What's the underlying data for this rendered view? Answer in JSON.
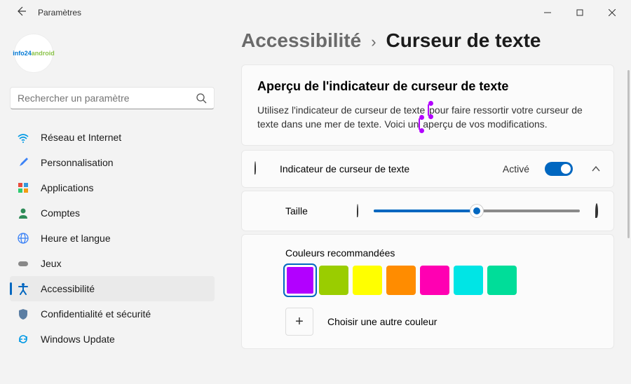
{
  "window": {
    "title": "Paramètres"
  },
  "avatar": {
    "brand_a": "info24",
    "brand_b": "android"
  },
  "search": {
    "placeholder": "Rechercher un paramètre"
  },
  "nav": {
    "items": [
      {
        "icon": "wifi",
        "label": "Réseau et Internet",
        "color": "#0099e5"
      },
      {
        "icon": "brush",
        "label": "Personnalisation",
        "color": "#3b82f6"
      },
      {
        "icon": "apps",
        "label": "Applications",
        "color": "#5b5b5b"
      },
      {
        "icon": "person",
        "label": "Comptes",
        "color": "#2e8b57"
      },
      {
        "icon": "globe",
        "label": "Heure et langue",
        "color": "#3b82f6"
      },
      {
        "icon": "gamepad",
        "label": "Jeux",
        "color": "#888"
      },
      {
        "icon": "accessibility",
        "label": "Accessibilité",
        "color": "#0067c0",
        "selected": true
      },
      {
        "icon": "shield",
        "label": "Confidentialité et sécurité",
        "color": "#5b7ea3"
      },
      {
        "icon": "sync",
        "label": "Windows Update",
        "color": "#0099e5"
      }
    ]
  },
  "breadcrumb": {
    "parent": "Accessibilité",
    "sep": "›",
    "current": "Curseur de texte"
  },
  "preview": {
    "title": "Aperçu de l'indicateur de curseur de texte",
    "body_a": "Utilisez l'indicateur de curseur de texte ",
    "body_b": "pour faire ressortir votre curseur de texte dans une mer de texte. Voici un",
    "body_c": " aperçu de vos modifications."
  },
  "indicator": {
    "label": "Indicateur de curseur de texte",
    "state": "Activé",
    "enabled": true
  },
  "size": {
    "label": "Taille",
    "value_percent": 50
  },
  "colors": {
    "title": "Couleurs recommandées",
    "swatches": [
      "#b200ff",
      "#9acd00",
      "#ffff00",
      "#ff8c00",
      "#ff00b2",
      "#00e5e5",
      "#00dd99"
    ],
    "selected_index": 0,
    "choose_label": "Choisir une autre couleur"
  }
}
